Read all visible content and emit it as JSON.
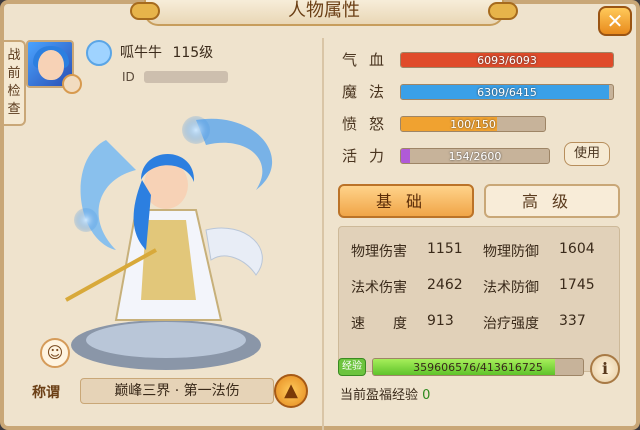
{
  "window": {
    "title": "人物属性",
    "close": "✕"
  },
  "side_tab": {
    "label_lines": [
      "战",
      "前",
      "检",
      "查"
    ]
  },
  "profile": {
    "name": "呱牛牛",
    "level": "115级",
    "id_label": "ID"
  },
  "character_title": {
    "label": "称谓",
    "value": "巅峰三界 · 第一法伤"
  },
  "stats": {
    "hp": {
      "label": "气血",
      "text": "6093/6093",
      "ratio": 1.0,
      "color": "#e04b2a"
    },
    "mp": {
      "label": "魔法",
      "text": "6309/6415",
      "ratio": 0.983,
      "color": "#3aa0e8"
    },
    "rage": {
      "label": "愤怒",
      "text": "100/150",
      "ratio": 0.667,
      "color": "#f0a230"
    },
    "vitality": {
      "label": "活力",
      "text": "154/2600",
      "ratio": 0.059,
      "color": "#b05ad8",
      "use_button": "使用"
    }
  },
  "tabs": {
    "basic": "基础",
    "advanced": "高级"
  },
  "attributes": [
    {
      "label": "物理伤害",
      "value": "1151"
    },
    {
      "label": "物理防御",
      "value": "1604"
    },
    {
      "label": "法术伤害",
      "value": "2462"
    },
    {
      "label": "法术防御",
      "value": "1745"
    },
    {
      "label": "速　　度",
      "value": "913"
    },
    {
      "label": "治疗强度",
      "value": "337"
    }
  ],
  "experience": {
    "badge": "经验",
    "text": "359606576/413616725",
    "ratio": 0.869,
    "bonus_label": "当前盈福经验",
    "bonus_value": "0"
  }
}
